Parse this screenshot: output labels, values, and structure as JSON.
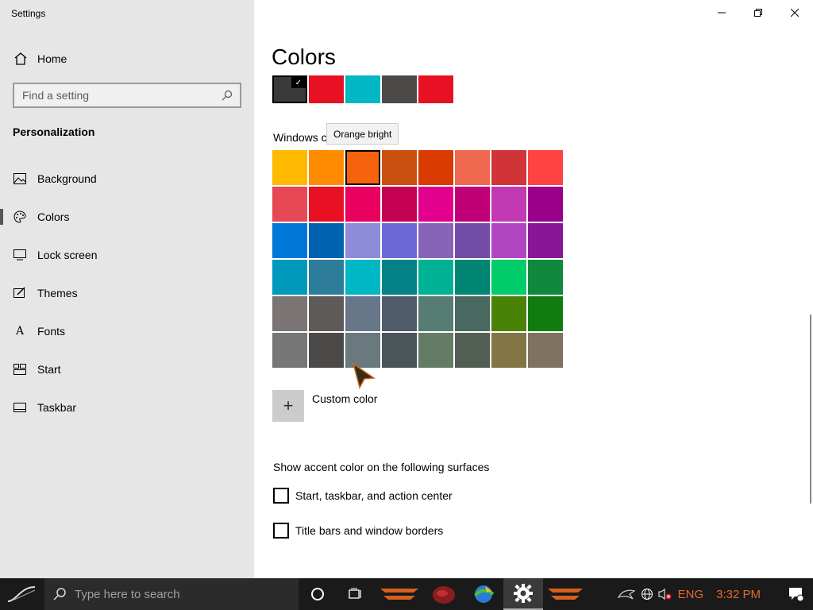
{
  "window": {
    "app_title": "Settings",
    "controls": {
      "minimize": "minimize-icon",
      "restore": "restore-icon",
      "close": "close-icon"
    }
  },
  "sidebar": {
    "home_label": "Home",
    "search_placeholder": "Find a setting",
    "section_title": "Personalization",
    "items": [
      {
        "label": "Background",
        "icon": "picture-icon",
        "selected": false
      },
      {
        "label": "Colors",
        "icon": "palette-icon",
        "selected": true
      },
      {
        "label": "Lock screen",
        "icon": "lock-screen-icon",
        "selected": false
      },
      {
        "label": "Themes",
        "icon": "themes-icon",
        "selected": false
      },
      {
        "label": "Fonts",
        "icon": "fonts-icon",
        "selected": false
      },
      {
        "label": "Start",
        "icon": "start-icon",
        "selected": false
      },
      {
        "label": "Taskbar",
        "icon": "taskbar-icon",
        "selected": false
      }
    ]
  },
  "main": {
    "title": "Colors",
    "recent_colors": [
      "#3a3a3a",
      "#e81123",
      "#00b7c3",
      "#4c4a48",
      "#e81123"
    ],
    "windows_colors_label": "Windows c",
    "tooltip": "Orange bright",
    "windows_colors": [
      [
        "#ffb900",
        "#ff8c00",
        "#f7630c",
        "#ca5010",
        "#da3b01",
        "#ef6950",
        "#d13438",
        "#ff4343"
      ],
      [
        "#e74856",
        "#e81123",
        "#ea005e",
        "#c30052",
        "#e3008c",
        "#bf0077",
        "#c239b3",
        "#9a0089"
      ],
      [
        "#0078d7",
        "#0063b1",
        "#8e8cd8",
        "#6b69d6",
        "#8764b8",
        "#744da9",
        "#b146c2",
        "#881798"
      ],
      [
        "#0099bc",
        "#2d7d9a",
        "#00b7c3",
        "#038387",
        "#00b294",
        "#018574",
        "#00cc6a",
        "#10893e"
      ],
      [
        "#7a7574",
        "#5d5a58",
        "#68768a",
        "#515c6b",
        "#567c73",
        "#486860",
        "#498205",
        "#107c10"
      ],
      [
        "#767676",
        "#4c4a48",
        "#69797e",
        "#4a5459",
        "#647c64",
        "#525e54",
        "#847545",
        "#7e735f"
      ]
    ],
    "selected_color": "#f7630c",
    "custom_color_label": "Custom color",
    "surfaces_label": "Show accent color on the following surfaces",
    "checkboxes": [
      {
        "label": "Start, taskbar, and action center",
        "checked": false
      },
      {
        "label": "Title bars and window borders",
        "checked": false
      }
    ]
  },
  "taskbar": {
    "search_placeholder": "Type here to search",
    "language": "ENG",
    "time": "3:32 PM"
  }
}
